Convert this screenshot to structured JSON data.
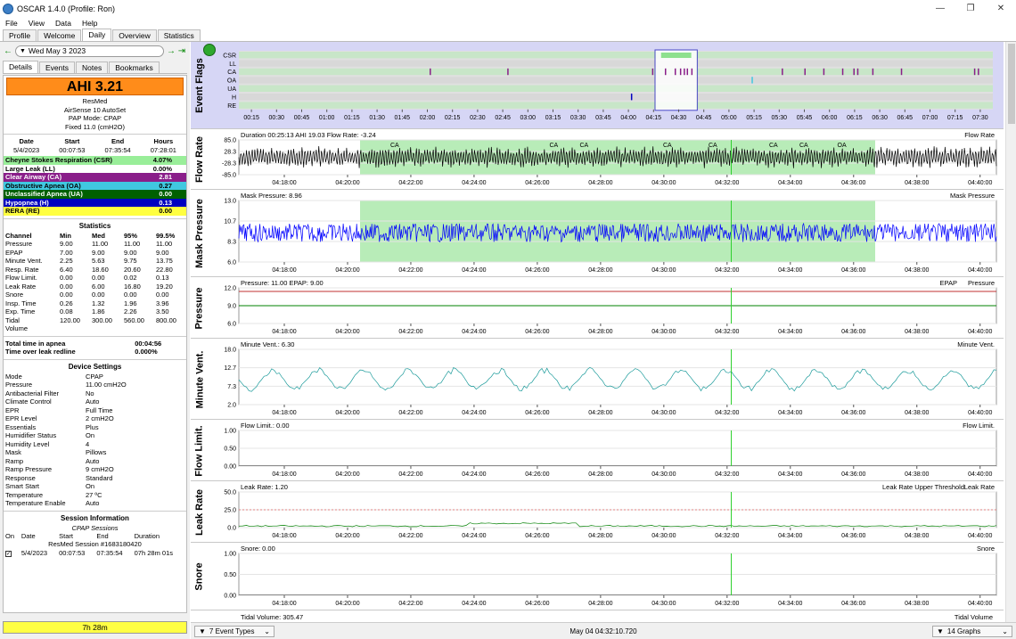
{
  "window": {
    "title": "OSCAR 1.4.0 (Profile: Ron)"
  },
  "menu": [
    "File",
    "View",
    "Data",
    "Help"
  ],
  "tabs": [
    "Profile",
    "Welcome",
    "Daily",
    "Overview",
    "Statistics"
  ],
  "date": "Wed May 3 2023",
  "subtabs": [
    "Details",
    "Events",
    "Notes",
    "Bookmarks"
  ],
  "ahi": "AHI 3.21",
  "device": [
    "ResMed",
    "AirSense 10 AutoSet",
    "PAP Mode: CPAP",
    "Fixed 11.0 (cmH2O)"
  ],
  "session_summary": {
    "headers": [
      "Date",
      "Start",
      "End",
      "Hours"
    ],
    "row": [
      "5/4/2023",
      "00:07:53",
      "07:35:54",
      "07:28:01"
    ]
  },
  "events": [
    {
      "label": "Cheyne Stokes Respiration (CSR)",
      "value": "4.07%",
      "bg": "#99ee99",
      "fg": "#000"
    },
    {
      "label": "Large Leak (LL)",
      "value": "0.00%",
      "bg": "#ffffff",
      "fg": "#000"
    },
    {
      "label": "Clear Airway (CA)",
      "value": "2.81",
      "bg": "#8a1e8a",
      "fg": "#fff"
    },
    {
      "label": "Obstructive Apnea (OA)",
      "value": "0.27",
      "bg": "#40c8e0",
      "fg": "#000"
    },
    {
      "label": "Unclassified Apnea (UA)",
      "value": "0.00",
      "bg": "#006000",
      "fg": "#fff"
    },
    {
      "label": "Hypopnea (H)",
      "value": "0.13",
      "bg": "#0000c0",
      "fg": "#fff"
    },
    {
      "label": "RERA (RE)",
      "value": "0.00",
      "bg": "#ffff40",
      "fg": "#000"
    }
  ],
  "statistics": {
    "title": "Statistics",
    "headers": [
      "Channel",
      "Min",
      "Med",
      "95%",
      "99.5%"
    ],
    "rows": [
      [
        "Pressure",
        "9.00",
        "11.00",
        "11.00",
        "11.00"
      ],
      [
        "EPAP",
        "7.00",
        "9.00",
        "9.00",
        "9.00"
      ],
      [
        "Minute Vent.",
        "2.25",
        "5.63",
        "9.75",
        "13.75"
      ],
      [
        "Resp. Rate",
        "6.40",
        "18.60",
        "20.60",
        "22.80"
      ],
      [
        "Flow Limit.",
        "0.00",
        "0.00",
        "0.02",
        "0.13"
      ],
      [
        "Leak Rate",
        "0.00",
        "6.00",
        "16.80",
        "19.20"
      ],
      [
        "Snore",
        "0.00",
        "0.00",
        "0.00",
        "0.00"
      ],
      [
        "Insp. Time",
        "0.26",
        "1.32",
        "1.96",
        "3.96"
      ],
      [
        "Exp. Time",
        "0.08",
        "1.86",
        "2.26",
        "3.50"
      ],
      [
        "Tidal",
        "120.00",
        "300.00",
        "560.00",
        "800.00"
      ],
      [
        "Volume",
        "",
        "",
        "",
        ""
      ]
    ]
  },
  "totals": [
    {
      "label": "Total time in apnea",
      "value": "00:04:56"
    },
    {
      "label": "Time over leak redline",
      "value": "0.000%"
    }
  ],
  "device_settings": {
    "title": "Device Settings",
    "rows": [
      [
        "Mode",
        "CPAP"
      ],
      [
        "Pressure",
        "11.00 cmH2O"
      ],
      [
        "Antibacterial Filter",
        "No"
      ],
      [
        "Climate Control",
        "Auto"
      ],
      [
        "EPR",
        "Full Time"
      ],
      [
        "EPR Level",
        "2 cmH2O"
      ],
      [
        "Essentials",
        "Plus"
      ],
      [
        "Humidifier Status",
        "On"
      ],
      [
        "Humidity Level",
        "4"
      ],
      [
        "Mask",
        "Pillows"
      ],
      [
        "Ramp",
        "Auto"
      ],
      [
        "Ramp Pressure",
        "9 cmH2O"
      ],
      [
        "Response",
        "Standard"
      ],
      [
        "Smart Start",
        "On"
      ],
      [
        "Temperature",
        "27 ºC"
      ],
      [
        "Temperature Enable",
        "Auto"
      ]
    ]
  },
  "session_info": {
    "title": "Session Information",
    "subtitle": "CPAP Sessions",
    "headers": [
      "On",
      "Date",
      "Start",
      "End",
      "Duration"
    ],
    "session_name": "ResMed Session #1683180420",
    "row": [
      "5/4/2023",
      "00:07:53",
      "07:35:54",
      "07h 28m 01s"
    ]
  },
  "bottom_total": "7h 28m",
  "status": {
    "event_types": "7 Event Types",
    "time": "May 04 04:32:10.720",
    "graphs": "14 Graphs"
  },
  "event_flags": {
    "title": "Event Flags",
    "rows": [
      "CSR",
      "LL",
      "CA",
      "OA",
      "UA",
      "H",
      "RE"
    ],
    "ticks": [
      "00:15",
      "00:30",
      "00:45",
      "01:00",
      "01:15",
      "01:30",
      "01:45",
      "02:00",
      "02:15",
      "02:30",
      "02:45",
      "03:00",
      "03:15",
      "03:30",
      "03:45",
      "04:00",
      "04:15",
      "04:30",
      "04:45",
      "05:00",
      "05:15",
      "05:30",
      "05:45",
      "06:00",
      "06:15",
      "06:30",
      "06:45",
      "07:00",
      "07:15",
      "07:30"
    ]
  },
  "time_ticks": [
    "04:18:00",
    "04:20:00",
    "04:22:00",
    "04:24:00",
    "04:26:00",
    "04:28:00",
    "04:30:00",
    "04:32:00",
    "04:34:00",
    "04:36:00",
    "04:38:00",
    "04:40:00"
  ],
  "graphs": [
    {
      "id": "flow",
      "title": "Flow Rate",
      "info": "Duration 00:25:13 AHI 19.03 Flow Rate: -3.24",
      "legend": "Flow Rate",
      "yticks": [
        "85.0",
        "28.3",
        "-28.3",
        "-85.0"
      ],
      "color": "#000000",
      "labels": [
        "CA",
        "CA",
        "CA",
        "CA",
        "CA",
        "CA",
        "CA",
        "OA"
      ]
    },
    {
      "id": "mask",
      "title": "Mask Pressure",
      "info": "Mask Pressure: 8.96",
      "legend": "Mask Pressure",
      "yticks": [
        "13.0",
        "10.7",
        "8.3",
        "6.0"
      ],
      "color": "#0000ff"
    },
    {
      "id": "pressure",
      "title": "Pressure",
      "info": "Pressure: 11.00 EPAP: 9.00",
      "legend": "EPAP",
      "legend2": "Pressure",
      "yticks": [
        "12.0",
        "9.0",
        "6.0"
      ],
      "color": "#008000"
    },
    {
      "id": "mv",
      "title": "Minute Vent.",
      "info": "Minute Vent.: 6.30",
      "legend": "Minute Vent.",
      "yticks": [
        "18.0",
        "12.7",
        "7.3",
        "2.0"
      ],
      "color": "#1a9a9a"
    },
    {
      "id": "fl",
      "title": "Flow Limit.",
      "info": "Flow Limit.: 0.00",
      "legend": "Flow Limit.",
      "yticks": [
        "1.00",
        "0.50",
        "0.00"
      ],
      "color": "#666666"
    },
    {
      "id": "leak",
      "title": "Leak Rate",
      "info": "Leak Rate: 1.20",
      "legend": "Leak Rate Upper Threshold",
      "legend2": "Leak Rate",
      "yticks": [
        "50.0",
        "25.0",
        "0.0"
      ],
      "color": "#008000"
    },
    {
      "id": "snore",
      "title": "Snore",
      "info": "Snore: 0.00",
      "legend": "Snore",
      "yticks": [
        "1.00",
        "0.50",
        "0.00"
      ],
      "color": "#666666"
    }
  ],
  "tidal_partial": {
    "info": "Tidal Volume: 305.47",
    "legend": "Tidal Volume"
  }
}
